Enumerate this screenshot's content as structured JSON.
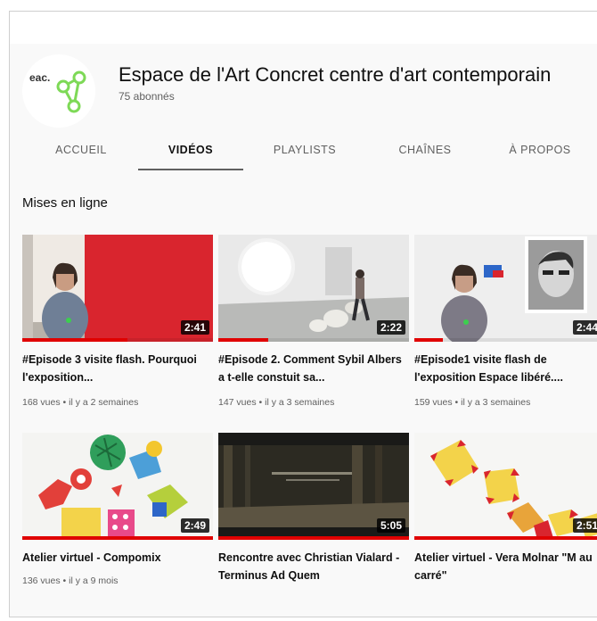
{
  "channel": {
    "name": "Espace de l'Art Concret centre d'art contemporain",
    "subscribers": "75 abonnés",
    "logo_text": "eac."
  },
  "tabs": [
    {
      "label": "ACCUEIL",
      "active": false
    },
    {
      "label": "VIDÉOS",
      "active": true
    },
    {
      "label": "PLAYLISTS",
      "active": false
    },
    {
      "label": "CHAÎNES",
      "active": false
    },
    {
      "label": "À PROPOS",
      "active": false
    }
  ],
  "section": {
    "title": "Mises en ligne"
  },
  "videos": [
    {
      "title": "#Episode 3 visite flash. Pourquoi l'exposition...",
      "meta": "168 vues • il y a 2 semaines",
      "duration": "2:41",
      "watched": 0.55
    },
    {
      "title": "#Episode 2. Comment Sybil Albers a t-elle constuit sa...",
      "meta": "147 vues • il y a 3 semaines",
      "duration": "2:22",
      "watched": 0.26
    },
    {
      "title": "#Episode1 visite flash de l'exposition Espace libéré....",
      "meta": "159 vues • il y a 3 semaines",
      "duration": "2:44",
      "watched": 0.15
    },
    {
      "title": "Atelier virtuel - Compomix",
      "meta": "136 vues • il y a 9 mois",
      "duration": "2:49",
      "watched": 1.0
    },
    {
      "title": "Rencontre avec Christian Vialard - Terminus Ad Quem",
      "meta": "",
      "duration": "5:05",
      "watched": 1.0
    },
    {
      "title": "Atelier virtuel - Vera Molnar \"M au carré\"",
      "meta": "",
      "duration": "2:51",
      "watched": 1.0
    }
  ],
  "colors": {
    "accent": "#e00000",
    "logo_green": "#7ed957"
  }
}
